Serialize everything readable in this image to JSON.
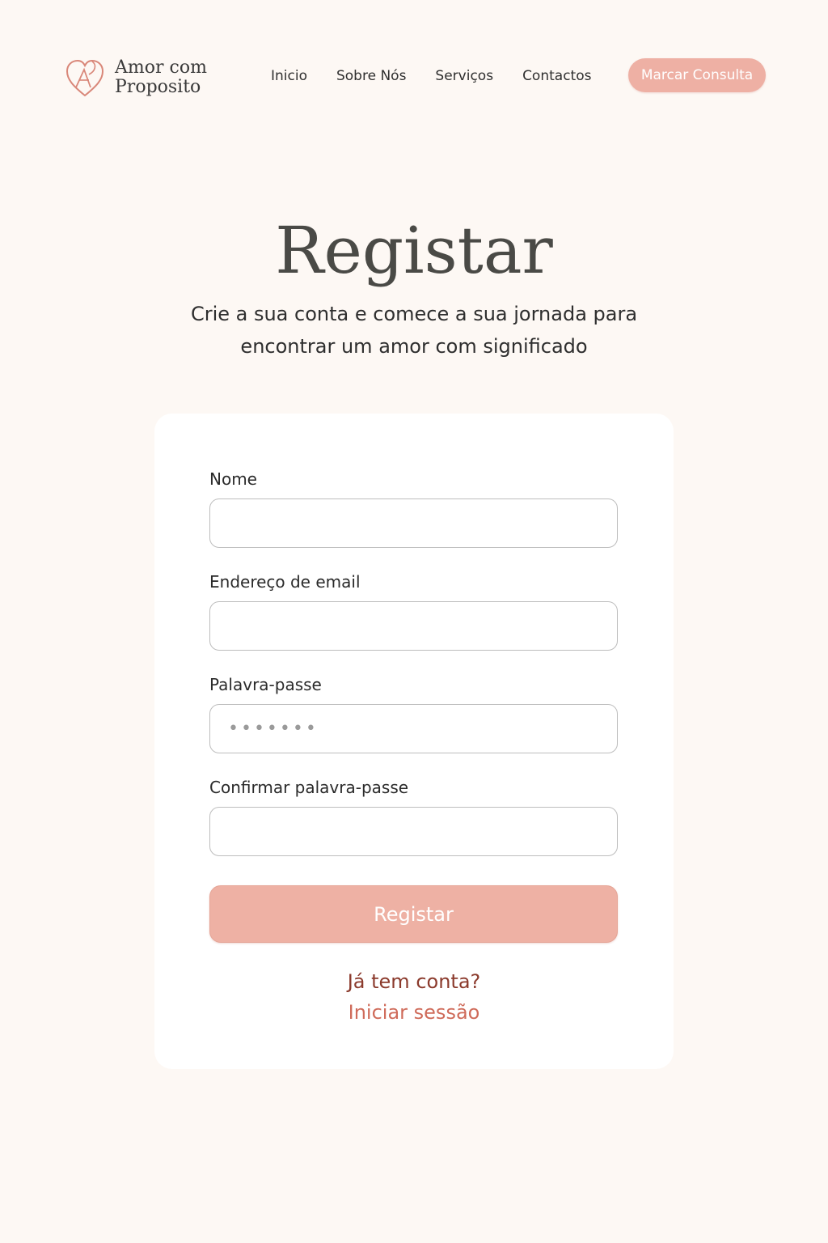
{
  "brand": {
    "line1": "Amor com",
    "line2": "Proposito",
    "accent_color": "#d98779"
  },
  "nav": {
    "items": [
      {
        "label": "Inicio"
      },
      {
        "label": "Sobre Nós"
      },
      {
        "label": "Serviços"
      },
      {
        "label": "Contactos"
      }
    ],
    "cta_label": "Marcar Consulta"
  },
  "hero": {
    "title": "Registar",
    "subtitle": "Crie a sua conta e comece a sua jornada para encontrar um amor com significado"
  },
  "form": {
    "fields": [
      {
        "label": "Nome",
        "value": ""
      },
      {
        "label": "Endereço de email",
        "value": ""
      },
      {
        "label": "Palavra-passe",
        "value": "•••••••"
      },
      {
        "label": "Confirmar palavra-passe",
        "value": ""
      }
    ],
    "submit_label": "Registar",
    "has_account_text": "Já tem conta?",
    "login_link": "Iniciar sessão"
  },
  "colors": {
    "background": "#fdf8f4",
    "primary_button": "#eeb1a4",
    "link_dark": "#8b3a2c",
    "link_light": "#cf6b5a"
  }
}
